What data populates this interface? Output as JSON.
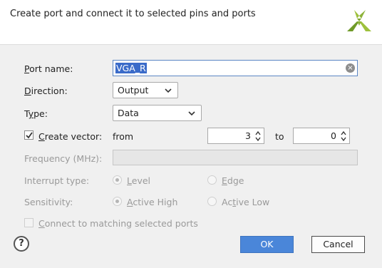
{
  "header": {
    "title": "Create port and connect it to selected pins and ports",
    "logo": "xilinx-logo-icon"
  },
  "port_name": {
    "label_ul": "P",
    "label_rest": "ort name:",
    "value": "VGA_R",
    "clear_icon": "clear-icon"
  },
  "direction": {
    "label_ul": "D",
    "label_rest": "irection:",
    "value": "Output"
  },
  "type": {
    "label_pre": "T",
    "label_ul": "y",
    "label_rest": "pe:",
    "value": "Data"
  },
  "vector": {
    "label_ul": "C",
    "label_rest": "reate vector:",
    "checked": true,
    "from_label": "from",
    "from_value": "3",
    "to_label": "to",
    "to_value": "0"
  },
  "frequency": {
    "label": "Frequency (MHz):",
    "value": ""
  },
  "interrupt": {
    "label": "Interrupt type:",
    "option1_ul": "L",
    "option1_rest": "evel",
    "option2_ul": "E",
    "option2_rest": "dge"
  },
  "sensitivity": {
    "label": "Sensitivity:",
    "option1_ul": "A",
    "option1_rest": "ctive High",
    "option2_pre": "Ac",
    "option2_ul": "t",
    "option2_rest": "ive Low"
  },
  "connect": {
    "label_ul": "C",
    "label_rest": "onnect to matching selected ports",
    "checked": false
  },
  "footer": {
    "help": "?",
    "ok": "OK",
    "cancel": "Cancel"
  },
  "colors": {
    "accent": "#4a86d9",
    "selection": "#3a6bc9",
    "logo": "#8db33a"
  }
}
